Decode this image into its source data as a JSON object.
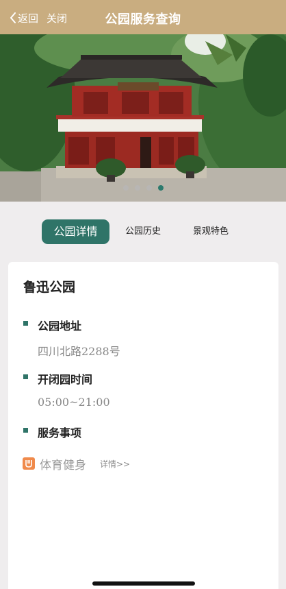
{
  "header": {
    "back_label": "返回",
    "close_label": "关闭",
    "title": "公园服务查询"
  },
  "banner": {
    "signboard_text": "聽 雨 軒",
    "slides": 4,
    "active_slide": 4
  },
  "tabs": [
    {
      "label": "公园详情",
      "active": true
    },
    {
      "label": "公园历史",
      "active": false
    },
    {
      "label": "景观特色",
      "active": false
    }
  ],
  "park": {
    "name": "鲁迅公园",
    "address_title": "公园地址",
    "address_value": "四川北路2288号",
    "hours_title": "开闭园时间",
    "hours_value": "05:00~21:00",
    "services_title": "服务事项",
    "services": [
      {
        "label": "体育健身",
        "link": "详情>>",
        "icon": "fitness-icon"
      }
    ]
  },
  "colors": {
    "header_bg": "#c9ad80",
    "accent": "#2f7468",
    "page_bg": "#efedee",
    "service_icon": "#f08a4b"
  }
}
